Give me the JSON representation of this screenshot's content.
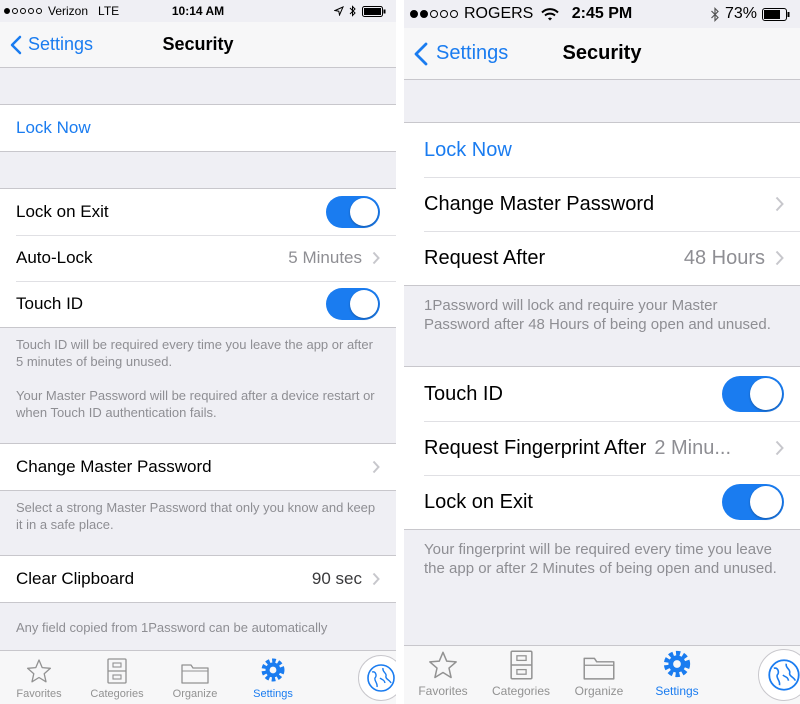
{
  "colors": {
    "accent": "#1a7cf0",
    "background": "#efeff4",
    "secondary_text": "#8e8e93"
  },
  "left": {
    "status": {
      "carrier": "Verizon",
      "network": "LTE",
      "time": "10:14 AM",
      "icons": [
        "location-icon",
        "bluetooth-icon",
        "battery-icon"
      ]
    },
    "nav": {
      "back_label": "Settings",
      "title": "Security"
    },
    "lock_now": "Lock Now",
    "lock_on_exit": {
      "label": "Lock on Exit",
      "on": true
    },
    "auto_lock": {
      "label": "Auto-Lock",
      "value": "5 Minutes"
    },
    "touch_id": {
      "label": "Touch ID",
      "on": true
    },
    "touch_id_footer_1": "Touch ID will be required every time you leave the app or after 5 minutes of being unused.",
    "touch_id_footer_2": "Your Master Password will be required after a device restart or when Touch ID authentication fails.",
    "change_master_password": {
      "label": "Change Master Password"
    },
    "master_password_footer": "Select a strong Master Password that only you know and keep it in a safe place.",
    "clear_clipboard": {
      "label": "Clear Clipboard",
      "value": "90 sec"
    },
    "clipboard_footer": "Any field copied from 1Password can be automatically"
  },
  "right": {
    "status": {
      "carrier": "ROGERS",
      "time": "2:45 PM",
      "battery": "73%",
      "icons": [
        "wifi-icon",
        "bluetooth-icon",
        "battery-icon"
      ]
    },
    "nav": {
      "back_label": "Settings",
      "title": "Security"
    },
    "lock_now": "Lock Now",
    "change_master_password": {
      "label": "Change Master Password"
    },
    "request_after": {
      "label": "Request After",
      "value": "48 Hours"
    },
    "request_footer": "1Password will lock and require your Master Password after 48 Hours of being open and unused.",
    "touch_id": {
      "label": "Touch ID",
      "on": true
    },
    "request_fingerprint": {
      "label": "Request Fingerprint After",
      "value": "2 Minu..."
    },
    "lock_on_exit": {
      "label": "Lock on Exit",
      "on": true
    },
    "fingerprint_footer": "Your fingerprint will be required every time you leave the app or after 2 Minutes of being open and unused."
  },
  "tabs": [
    {
      "label": "Favorites",
      "icon": "star-icon"
    },
    {
      "label": "Categories",
      "icon": "cabinet-icon"
    },
    {
      "label": "Organize",
      "icon": "folder-icon"
    },
    {
      "label": "Settings",
      "icon": "gear-icon",
      "active": true
    }
  ]
}
